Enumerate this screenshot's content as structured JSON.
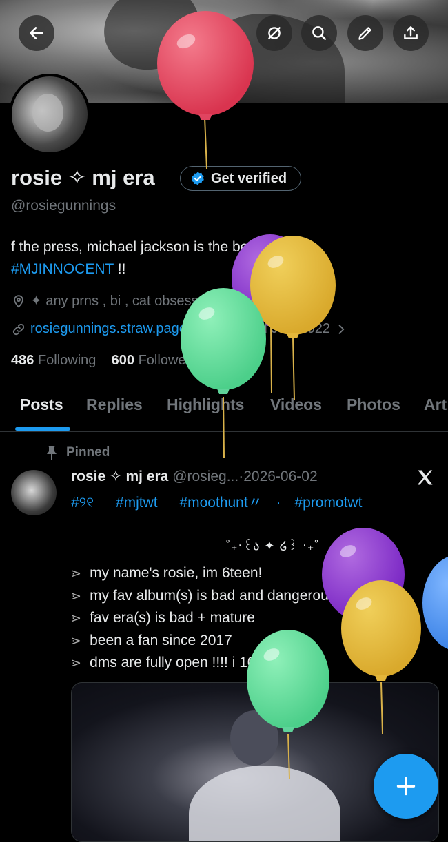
{
  "profile": {
    "display_name": "rosie ✧ mj era",
    "verify_label": "Get verified",
    "handle": "@rosiegunnings",
    "bio_text": "f the press, michael jackson is the best ! ✦ 17",
    "bio_tag": "#MJINNOCENT",
    "bio_tail": " !!",
    "location": "✦ any prns , bi , cat obsessed",
    "website": "rosiegunnings.straw.page",
    "joined": "Joined July 2022",
    "following_count": "486",
    "following_label": "Following",
    "followers_count": "600",
    "followers_label": "Followers"
  },
  "tabs": [
    "Posts",
    "Replies",
    "Highlights",
    "Videos",
    "Photos",
    "Art"
  ],
  "pinned_post": {
    "pinned_label": "Pinned",
    "name": "rosie ✧ mj era",
    "handle": "@rosieg...",
    "date": "·2026-06-02",
    "hashtags": [
      "#୨୧",
      "#mjtwt",
      "#moothunt〃",
      "·",
      "#promotwt"
    ],
    "deco": "˚₊‧꒰ა ✦ ໒꒱ ‧₊˚",
    "lines": [
      "my name's rosie, im 6teen!",
      "my fav album(s) is bad and dangerous !!",
      "fav era(s) is bad + mature",
      "been a fan since 2017",
      "dms are fully open !!!! i 100% fb <3"
    ]
  },
  "icons": [
    "back-arrow-icon",
    "no-notifications-icon",
    "search-icon",
    "edit-icon",
    "share-icon",
    "verified-badge-icon",
    "location-icon",
    "link-icon",
    "calendar-icon",
    "chevron-right-icon",
    "pin-icon",
    "x-logo-icon",
    "plus-icon"
  ],
  "colors": {
    "accent": "#1d9bf0",
    "muted": "#71767b",
    "text": "#e7e9ea",
    "background": "#000000"
  }
}
